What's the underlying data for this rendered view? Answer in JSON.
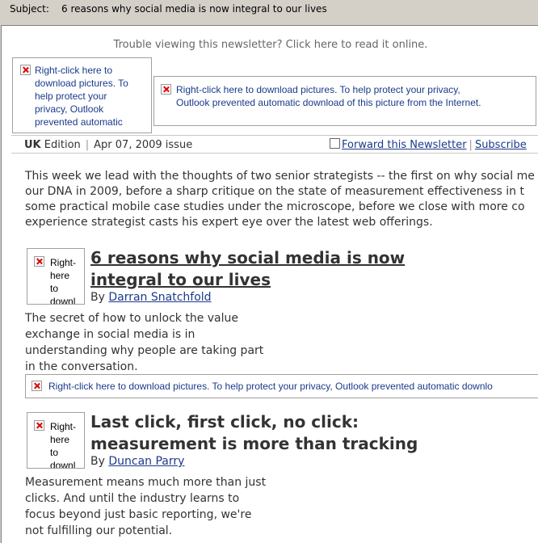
{
  "header": {
    "subject_label": "Subject:",
    "subject_value": "6 reasons why social media is now integral to our lives"
  },
  "newsletter": {
    "trouble_text": "Trouble viewing this newsletter? Click here to read it online.",
    "placeholder_small": [
      "Right-click here to",
      "download pictures. To",
      "help protect your",
      "privacy, Outlook",
      "prevented automatic"
    ],
    "placeholder_wide": [
      "Right-click here to download pictures. To help protect your privacy,",
      "Outlook prevented automatic download of this picture from the Internet."
    ],
    "edition": {
      "region": "UK",
      "label": "Edition",
      "issue": "Apr 07, 2009 issue"
    },
    "forward_label": "Forward this Newsletter",
    "subscribe_label": "Subscribe",
    "intro_lines": [
      "This week we lead with the thoughts of two senior strategists -- the first on why social me",
      "our DNA in 2009, before a sharp critique on the state of measurement effectiveness in t",
      "some practical mobile case studies under the microscope, before we close with more co",
      "experience strategist casts his expert eye over the latest web offerings."
    ],
    "thumb_lines": [
      "Right-",
      "here",
      "to",
      "downl"
    ],
    "articles": [
      {
        "title_lines": [
          "6 reasons why social media is now",
          "integral to our lives"
        ],
        "by": "By",
        "author": "Darran Snatchfold",
        "desc_lines": [
          "The secret of how to unlock the value",
          "exchange in social media is in",
          "understanding why people are taking part",
          "in the conversation."
        ]
      },
      {
        "title_lines": [
          "Last click, first click, no click:",
          "measurement is more than tracking"
        ],
        "by": "By",
        "author": "Duncan Parry",
        "desc_lines": [
          "Measurement means much more than just",
          "clicks. And until the industry learns to",
          "focus beyond just basic reporting, we're",
          "not fulfilling our potential."
        ]
      }
    ],
    "banner_placeholder": "Right-click here to download pictures. To help protect your privacy, Outlook prevented automatic downlo"
  }
}
